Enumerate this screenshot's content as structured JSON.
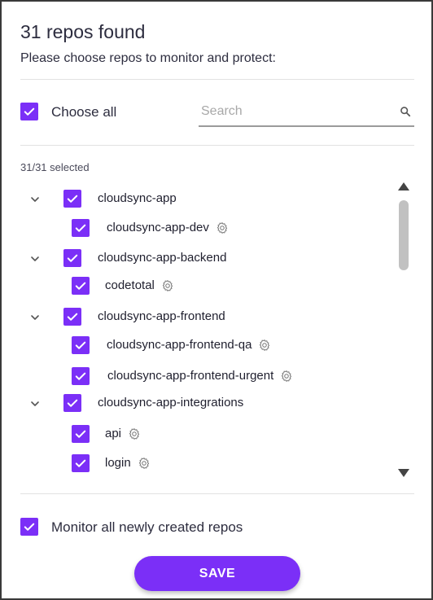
{
  "dialog": {
    "title": "31 repos found",
    "subtitle": "Please choose repos to monitor and protect:"
  },
  "choose_all": {
    "label": "Choose all",
    "checked": true
  },
  "search": {
    "placeholder": "Search",
    "value": "",
    "icon": "search-icon"
  },
  "selected_count": "31/31 selected",
  "repos": [
    {
      "label": "cloudsync-app",
      "level": 0,
      "checked": true,
      "expandable": true,
      "gear": false
    },
    {
      "label": "cloudsync-app-dev",
      "level": 1,
      "checked": true,
      "expandable": false,
      "gear": true
    },
    {
      "label": "cloudsync-app-backend",
      "level": 0,
      "checked": true,
      "expandable": true,
      "gear": false
    },
    {
      "label": "codetotal",
      "level": 1,
      "checked": true,
      "expandable": false,
      "gear": true
    },
    {
      "label": "cloudsync-app-frontend",
      "level": 0,
      "checked": true,
      "expandable": true,
      "gear": false
    },
    {
      "label": "cloudsync-app-frontend-qa",
      "level": 1,
      "checked": true,
      "expandable": false,
      "gear": true
    },
    {
      "label": "cloudsync-app-frontend-urgent",
      "level": 1,
      "checked": true,
      "expandable": false,
      "gear": true
    },
    {
      "label": "cloudsync-app-integrations",
      "level": 0,
      "checked": true,
      "expandable": true,
      "gear": false
    },
    {
      "label": "api",
      "level": 1,
      "checked": true,
      "expandable": false,
      "gear": true
    },
    {
      "label": "login",
      "level": 1,
      "checked": true,
      "expandable": false,
      "gear": true
    }
  ],
  "monitor_new": {
    "label": "Monitor all newly created repos",
    "checked": true
  },
  "save_button": {
    "label": "SAVE"
  },
  "colors": {
    "accent": "#7b2ff7",
    "text": "#2d2d3f",
    "divider": "#e2e2e2"
  }
}
